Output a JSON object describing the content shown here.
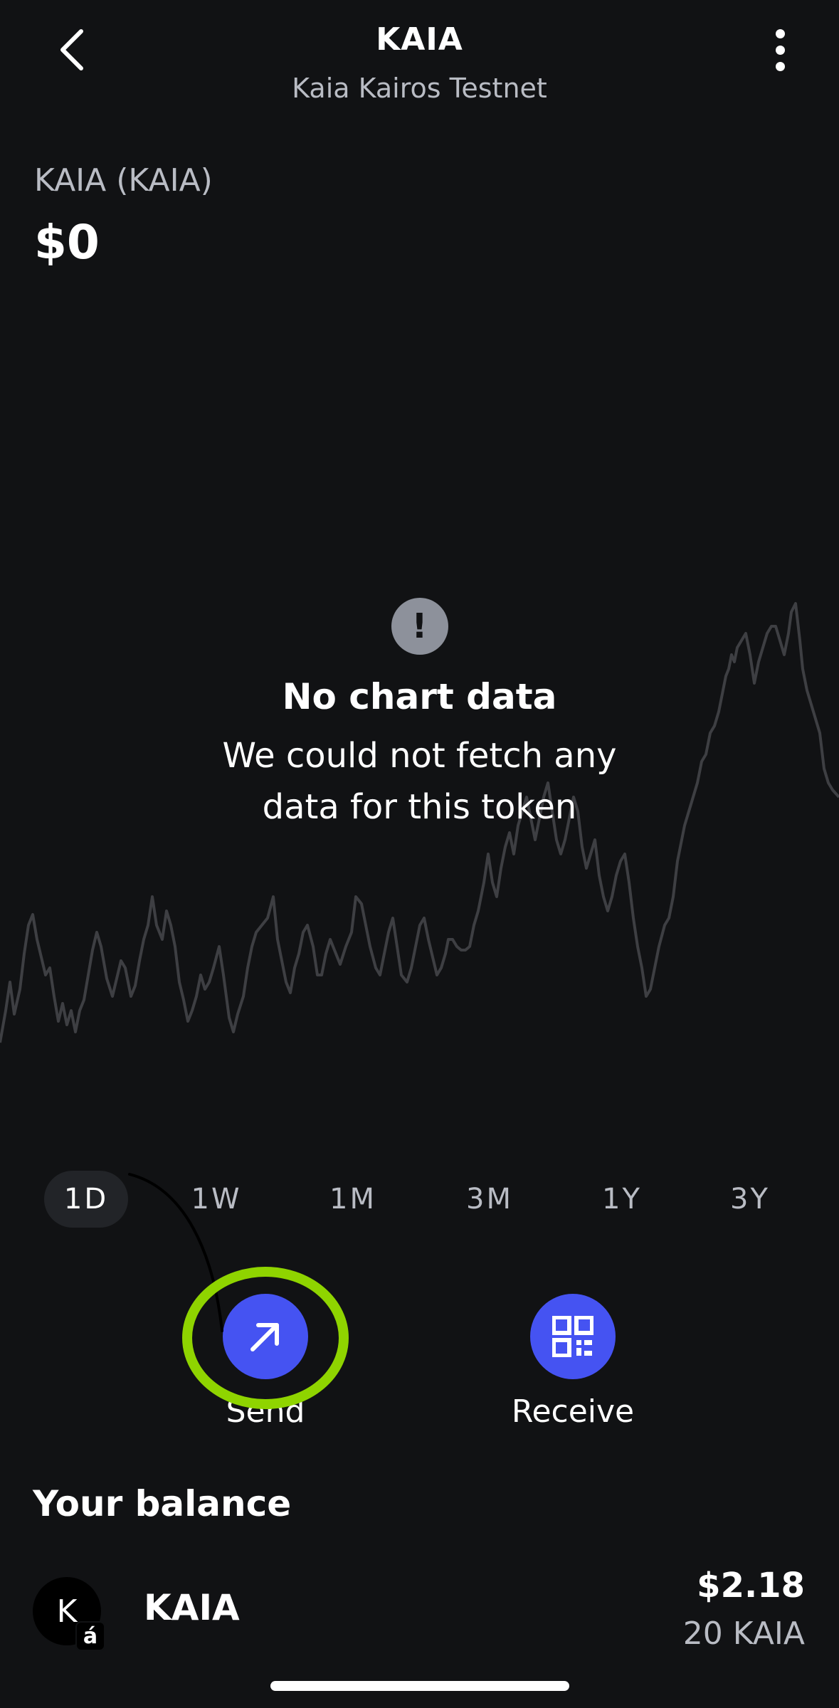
{
  "header": {
    "title": "KAIA",
    "subtitle": "Kaia Kairos Testnet",
    "back_icon": "chevron-left-icon",
    "menu_icon": "more-vertical-icon"
  },
  "token": {
    "name": "KAIA (KAIA)",
    "value": "$0"
  },
  "chart": {
    "warning_icon": "exclamation-icon",
    "warning_glyph": "!",
    "no_data_title": "No chart data",
    "no_data_message": "We could not fetch any data for this token",
    "line_color": "#3e3f43"
  },
  "range_tabs": [
    {
      "label": "1D",
      "active": true
    },
    {
      "label": "1W",
      "active": false
    },
    {
      "label": "1M",
      "active": false
    },
    {
      "label": "3M",
      "active": false
    },
    {
      "label": "1Y",
      "active": false
    },
    {
      "label": "3Y",
      "active": false
    }
  ],
  "actions": {
    "send_label": "Send",
    "send_icon": "arrow-up-right-icon",
    "receive_label": "Receive",
    "receive_icon": "qr-code-icon",
    "accent_color": "#4553f2",
    "highlight_color": "#8fd400"
  },
  "balance": {
    "title": "Your balance",
    "items": [
      {
        "avatar_letter": "K",
        "badge_glyph": "á",
        "name": "KAIA",
        "usd": "$2.18",
        "amount": "20 KAIA"
      }
    ]
  }
}
